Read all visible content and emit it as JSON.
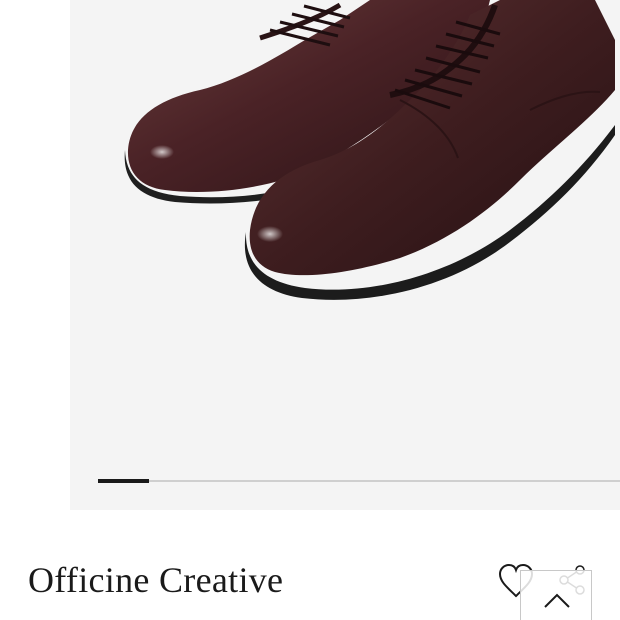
{
  "product": {
    "brand": "Officine Creative",
    "image_subject": "shoe-photo",
    "gallery": {
      "current_index": 1,
      "total_images": 11,
      "progress_fraction": 0.09
    }
  },
  "actions": {
    "wishlist_icon": "heart-outline-icon",
    "share_icon": "share-icon",
    "scroll_top_icon": "chevron-up-icon"
  },
  "colors": {
    "text": "#1a1a1a",
    "gallery_bg": "#f4f4f4",
    "progress_track": "#cfcfcf",
    "progress_fill": "#1a1a1a",
    "leather": "#3e1d1f"
  }
}
